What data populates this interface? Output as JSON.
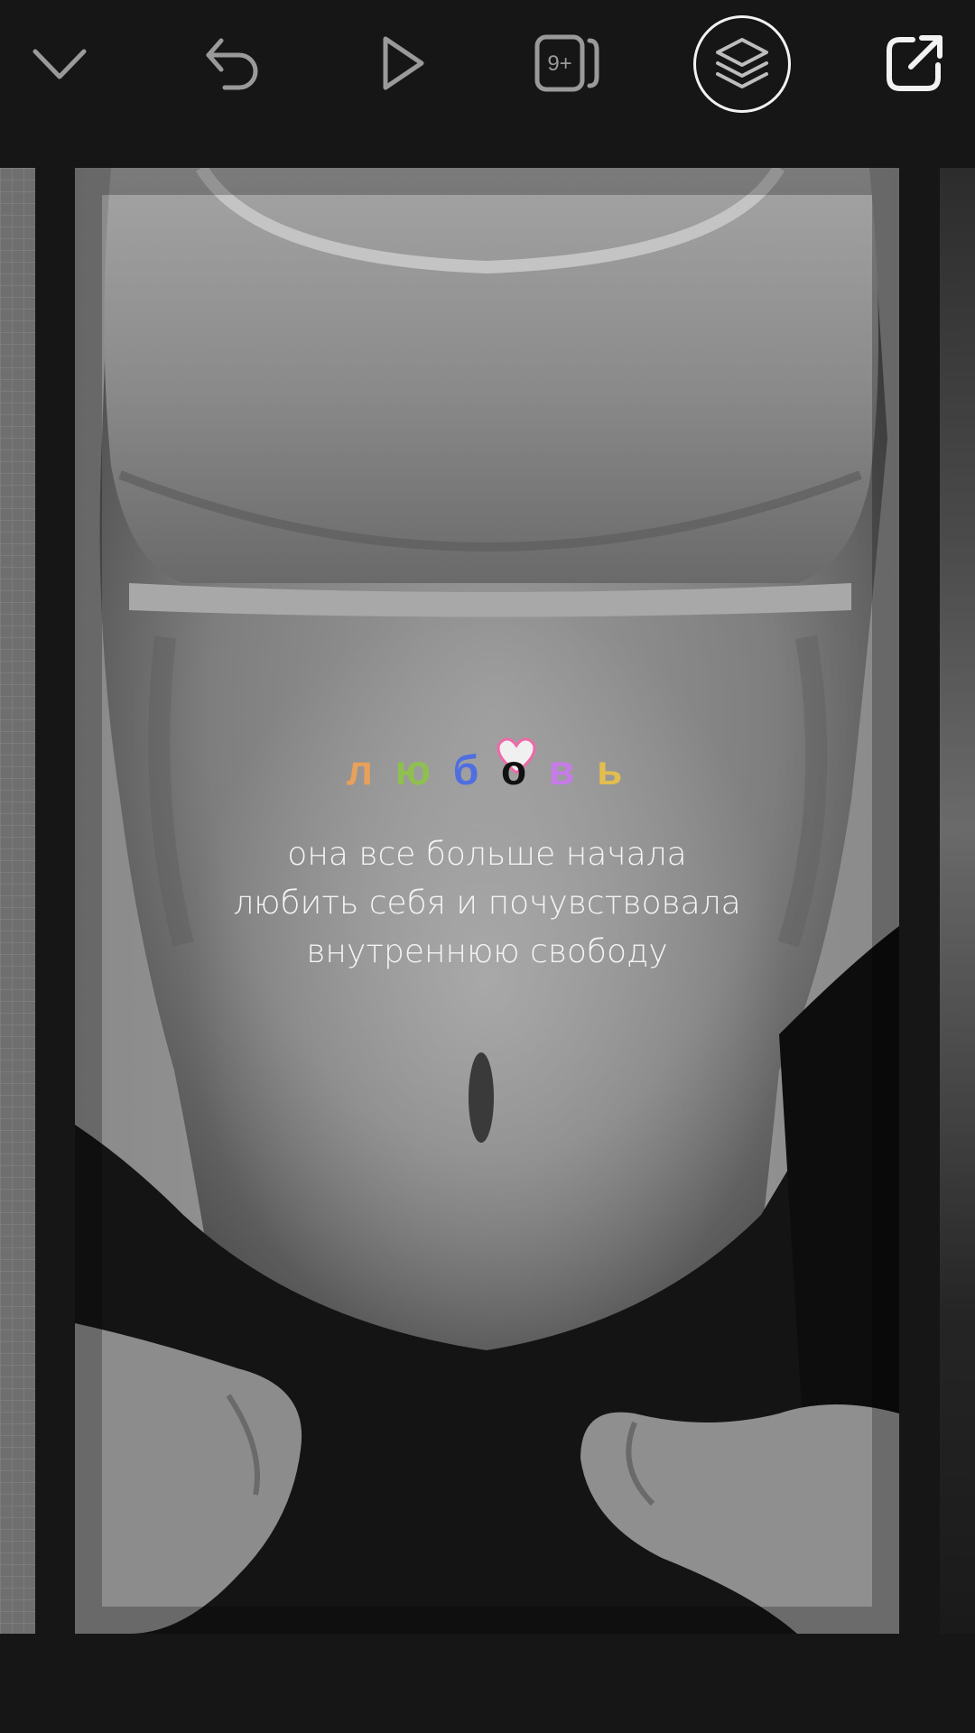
{
  "toolbar": {
    "icons": [
      "chevron-down-icon",
      "undo-icon",
      "play-icon",
      "pages-count-icon",
      "layers-icon",
      "share-icon"
    ],
    "pages_badge": "9+"
  },
  "slide": {
    "title_letters": [
      {
        "char": "л",
        "color": "#e8a05a"
      },
      {
        "char": "ю",
        "color": "#8fc04f"
      },
      {
        "char": "б",
        "color": "#4f6ee0"
      },
      {
        "char": "о",
        "color": "#111111"
      },
      {
        "char": "в",
        "color": "#c77be8"
      },
      {
        "char": "ь",
        "color": "#e2bd4f"
      }
    ],
    "heart_color": "#ee6aa8",
    "caption_lines": [
      "она все больше начала",
      "любить себя и почувствовала",
      "внутреннюю свободу"
    ]
  },
  "colors": {
    "background": "#161616",
    "icon": "#9a9a9a",
    "icon_active": "#f2f2f2"
  }
}
